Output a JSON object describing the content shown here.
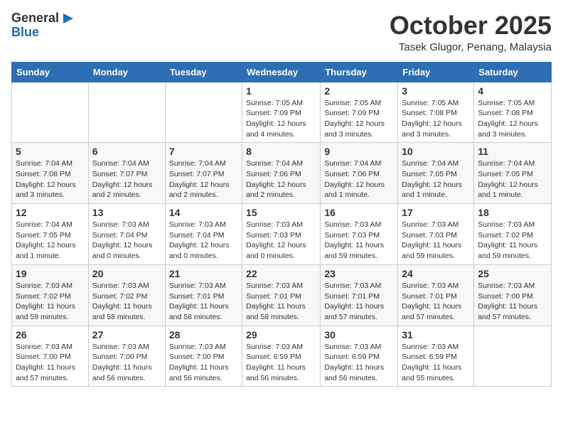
{
  "header": {
    "logo_general": "General",
    "logo_blue": "Blue",
    "month_title": "October 2025",
    "location": "Tasek Glugor, Penang, Malaysia"
  },
  "days_of_week": [
    "Sunday",
    "Monday",
    "Tuesday",
    "Wednesday",
    "Thursday",
    "Friday",
    "Saturday"
  ],
  "weeks": [
    [
      {
        "day": "",
        "info": ""
      },
      {
        "day": "",
        "info": ""
      },
      {
        "day": "",
        "info": ""
      },
      {
        "day": "1",
        "info": "Sunrise: 7:05 AM\nSunset: 7:09 PM\nDaylight: 12 hours and 4 minutes."
      },
      {
        "day": "2",
        "info": "Sunrise: 7:05 AM\nSunset: 7:09 PM\nDaylight: 12 hours and 3 minutes."
      },
      {
        "day": "3",
        "info": "Sunrise: 7:05 AM\nSunset: 7:08 PM\nDaylight: 12 hours and 3 minutes."
      },
      {
        "day": "4",
        "info": "Sunrise: 7:05 AM\nSunset: 7:08 PM\nDaylight: 12 hours and 3 minutes."
      }
    ],
    [
      {
        "day": "5",
        "info": "Sunrise: 7:04 AM\nSunset: 7:08 PM\nDaylight: 12 hours and 3 minutes."
      },
      {
        "day": "6",
        "info": "Sunrise: 7:04 AM\nSunset: 7:07 PM\nDaylight: 12 hours and 2 minutes."
      },
      {
        "day": "7",
        "info": "Sunrise: 7:04 AM\nSunset: 7:07 PM\nDaylight: 12 hours and 2 minutes."
      },
      {
        "day": "8",
        "info": "Sunrise: 7:04 AM\nSunset: 7:06 PM\nDaylight: 12 hours and 2 minutes."
      },
      {
        "day": "9",
        "info": "Sunrise: 7:04 AM\nSunset: 7:06 PM\nDaylight: 12 hours and 1 minute."
      },
      {
        "day": "10",
        "info": "Sunrise: 7:04 AM\nSunset: 7:05 PM\nDaylight: 12 hours and 1 minute."
      },
      {
        "day": "11",
        "info": "Sunrise: 7:04 AM\nSunset: 7:05 PM\nDaylight: 12 hours and 1 minute."
      }
    ],
    [
      {
        "day": "12",
        "info": "Sunrise: 7:04 AM\nSunset: 7:05 PM\nDaylight: 12 hours and 1 minute."
      },
      {
        "day": "13",
        "info": "Sunrise: 7:03 AM\nSunset: 7:04 PM\nDaylight: 12 hours and 0 minutes."
      },
      {
        "day": "14",
        "info": "Sunrise: 7:03 AM\nSunset: 7:04 PM\nDaylight: 12 hours and 0 minutes."
      },
      {
        "day": "15",
        "info": "Sunrise: 7:03 AM\nSunset: 7:03 PM\nDaylight: 12 hours and 0 minutes."
      },
      {
        "day": "16",
        "info": "Sunrise: 7:03 AM\nSunset: 7:03 PM\nDaylight: 11 hours and 59 minutes."
      },
      {
        "day": "17",
        "info": "Sunrise: 7:03 AM\nSunset: 7:03 PM\nDaylight: 11 hours and 59 minutes."
      },
      {
        "day": "18",
        "info": "Sunrise: 7:03 AM\nSunset: 7:02 PM\nDaylight: 11 hours and 59 minutes."
      }
    ],
    [
      {
        "day": "19",
        "info": "Sunrise: 7:03 AM\nSunset: 7:02 PM\nDaylight: 11 hours and 59 minutes."
      },
      {
        "day": "20",
        "info": "Sunrise: 7:03 AM\nSunset: 7:02 PM\nDaylight: 11 hours and 58 minutes."
      },
      {
        "day": "21",
        "info": "Sunrise: 7:03 AM\nSunset: 7:01 PM\nDaylight: 11 hours and 58 minutes."
      },
      {
        "day": "22",
        "info": "Sunrise: 7:03 AM\nSunset: 7:01 PM\nDaylight: 11 hours and 58 minutes."
      },
      {
        "day": "23",
        "info": "Sunrise: 7:03 AM\nSunset: 7:01 PM\nDaylight: 11 hours and 57 minutes."
      },
      {
        "day": "24",
        "info": "Sunrise: 7:03 AM\nSunset: 7:01 PM\nDaylight: 11 hours and 57 minutes."
      },
      {
        "day": "25",
        "info": "Sunrise: 7:03 AM\nSunset: 7:00 PM\nDaylight: 11 hours and 57 minutes."
      }
    ],
    [
      {
        "day": "26",
        "info": "Sunrise: 7:03 AM\nSunset: 7:00 PM\nDaylight: 11 hours and 57 minutes."
      },
      {
        "day": "27",
        "info": "Sunrise: 7:03 AM\nSunset: 7:00 PM\nDaylight: 11 hours and 56 minutes."
      },
      {
        "day": "28",
        "info": "Sunrise: 7:03 AM\nSunset: 7:00 PM\nDaylight: 11 hours and 56 minutes."
      },
      {
        "day": "29",
        "info": "Sunrise: 7:03 AM\nSunset: 6:59 PM\nDaylight: 11 hours and 56 minutes."
      },
      {
        "day": "30",
        "info": "Sunrise: 7:03 AM\nSunset: 6:59 PM\nDaylight: 11 hours and 56 minutes."
      },
      {
        "day": "31",
        "info": "Sunrise: 7:03 AM\nSunset: 6:59 PM\nDaylight: 11 hours and 55 minutes."
      },
      {
        "day": "",
        "info": ""
      }
    ]
  ]
}
